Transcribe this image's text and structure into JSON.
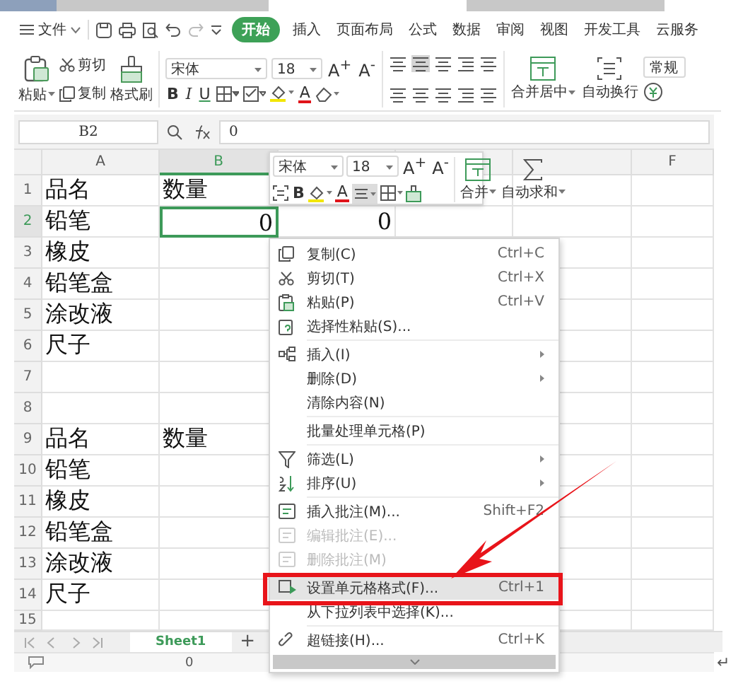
{
  "menu_bar": {
    "file_label": "文件",
    "tabs": [
      {
        "label": "开始",
        "selected": true
      },
      {
        "label": "插入",
        "selected": false
      },
      {
        "label": "页面布局",
        "selected": false
      },
      {
        "label": "公式",
        "selected": false
      },
      {
        "label": "数据",
        "selected": false
      },
      {
        "label": "审阅",
        "selected": false
      },
      {
        "label": "视图",
        "selected": false
      },
      {
        "label": "开发工具",
        "selected": false
      },
      {
        "label": "云服务",
        "selected": false
      }
    ]
  },
  "ribbon": {
    "paste_label": "粘贴",
    "cut_label": "剪切",
    "copy_label": "复制",
    "format_painter_label": "格式刷",
    "font_name": "宋体",
    "font_size": "18",
    "grow_font": "A$^{+}$",
    "shrink_font": "A$^{-}$",
    "bold": "B",
    "italic": "I",
    "underline": "U",
    "font_color": "A",
    "merge_label": "合并居中",
    "wrap_label": "自动换行",
    "number_format": "常规"
  },
  "formula_bar": {
    "cell_ref": "B2",
    "value": "0"
  },
  "sheet": {
    "columns": [
      {
        "label": "A",
        "selected": false
      },
      {
        "label": "B",
        "selected": true
      },
      {
        "label": "F",
        "selected": false
      }
    ],
    "rows": [
      {
        "number": "1",
        "selected": false,
        "cells": [
          {
            "text": "品名",
            "kind": "text"
          },
          {
            "text": "数量",
            "kind": "text"
          }
        ]
      },
      {
        "number": "2",
        "selected": true,
        "cells": [
          {
            "text": "铅笔",
            "kind": "text"
          },
          {
            "text": "0",
            "kind": "number"
          },
          {
            "text": "0",
            "kind": "number"
          }
        ]
      },
      {
        "number": "3",
        "selected": false,
        "cells": [
          {
            "text": "橡皮",
            "kind": "text"
          }
        ]
      },
      {
        "number": "4",
        "selected": false,
        "cells": [
          {
            "text": "铅笔盒",
            "kind": "text"
          }
        ]
      },
      {
        "number": "5",
        "selected": false,
        "cells": [
          {
            "text": "涂改液",
            "kind": "text"
          }
        ]
      },
      {
        "number": "6",
        "selected": false,
        "cells": [
          {
            "text": "尺子",
            "kind": "text"
          }
        ]
      },
      {
        "number": "7",
        "selected": false,
        "cells": []
      },
      {
        "number": "8",
        "selected": false,
        "cells": []
      },
      {
        "number": "9",
        "selected": false,
        "cells": [
          {
            "text": "品名",
            "kind": "text"
          },
          {
            "text": "数量",
            "kind": "text"
          }
        ]
      },
      {
        "number": "10",
        "selected": false,
        "cells": [
          {
            "text": "铅笔",
            "kind": "text"
          }
        ]
      },
      {
        "number": "11",
        "selected": false,
        "cells": [
          {
            "text": "橡皮",
            "kind": "text"
          }
        ]
      },
      {
        "number": "12",
        "selected": false,
        "cells": [
          {
            "text": "铅笔盒",
            "kind": "text"
          }
        ]
      },
      {
        "number": "13",
        "selected": false,
        "cells": [
          {
            "text": "涂改液",
            "kind": "text"
          }
        ]
      },
      {
        "number": "14",
        "selected": false,
        "cells": [
          {
            "text": "尺子",
            "kind": "text"
          }
        ]
      },
      {
        "number": "15",
        "selected": false,
        "cells": []
      }
    ]
  },
  "sheet_tabs": {
    "tabs": [
      {
        "label": "Sheet1",
        "selected": true
      }
    ],
    "add_label": "+"
  },
  "status_bar": {
    "value": "0"
  },
  "mini_toolbar": {
    "font_name": "宋体",
    "font_size": "18",
    "grow_font": "A$^{+}$",
    "shrink_font": "A$^{-}$",
    "bold": "B",
    "font_color": "A",
    "merge_label": "合并",
    "sum_label": "自动求和"
  },
  "context_menu": {
    "items": [
      {
        "kind": "item",
        "label": "复制(C)",
        "shortcut": "Ctrl+C",
        "submenu": false,
        "selected": false,
        "disabled": false
      },
      {
        "kind": "item",
        "label": "剪切(T)",
        "shortcut": "Ctrl+X",
        "submenu": false,
        "selected": false,
        "disabled": false
      },
      {
        "kind": "item",
        "label": "粘贴(P)",
        "shortcut": "Ctrl+V",
        "submenu": false,
        "selected": false,
        "disabled": false
      },
      {
        "kind": "item",
        "label": "选择性粘贴(S)...",
        "submenu": false,
        "selected": false,
        "disabled": false
      },
      {
        "kind": "separator"
      },
      {
        "kind": "item",
        "label": "插入(I)",
        "submenu": true,
        "selected": false,
        "disabled": false
      },
      {
        "kind": "item",
        "label": "删除(D)",
        "submenu": true,
        "selected": false,
        "disabled": false
      },
      {
        "kind": "item",
        "label": "清除内容(N)",
        "submenu": false,
        "selected": false,
        "disabled": false
      },
      {
        "kind": "separator"
      },
      {
        "kind": "item",
        "label": "批量处理单元格(P)",
        "submenu": false,
        "selected": false,
        "disabled": false
      },
      {
        "kind": "separator"
      },
      {
        "kind": "item",
        "label": "筛选(L)",
        "submenu": true,
        "selected": false,
        "disabled": false
      },
      {
        "kind": "item",
        "label": "排序(U)",
        "submenu": true,
        "selected": false,
        "disabled": false
      },
      {
        "kind": "separator"
      },
      {
        "kind": "item",
        "label": "插入批注(M)...",
        "shortcut": "Shift+F2",
        "submenu": false,
        "selected": false,
        "disabled": false
      },
      {
        "kind": "item",
        "label": "编辑批注(E)...",
        "submenu": false,
        "selected": false,
        "disabled": true
      },
      {
        "kind": "item",
        "label": "删除批注(M)",
        "submenu": false,
        "selected": false,
        "disabled": true
      },
      {
        "kind": "separator"
      },
      {
        "kind": "item",
        "label": "设置单元格格式(F)...",
        "shortcut": "Ctrl+1",
        "submenu": false,
        "selected": true,
        "disabled": false
      },
      {
        "kind": "item",
        "label": "从下拉列表中选择(K)...",
        "submenu": false,
        "selected": false,
        "disabled": false
      },
      {
        "kind": "separator"
      },
      {
        "kind": "item",
        "label": "超链接(H)...",
        "shortcut": "Ctrl+K",
        "submenu": false,
        "selected": false,
        "disabled": false
      }
    ]
  },
  "paragraph_mark": "↵"
}
